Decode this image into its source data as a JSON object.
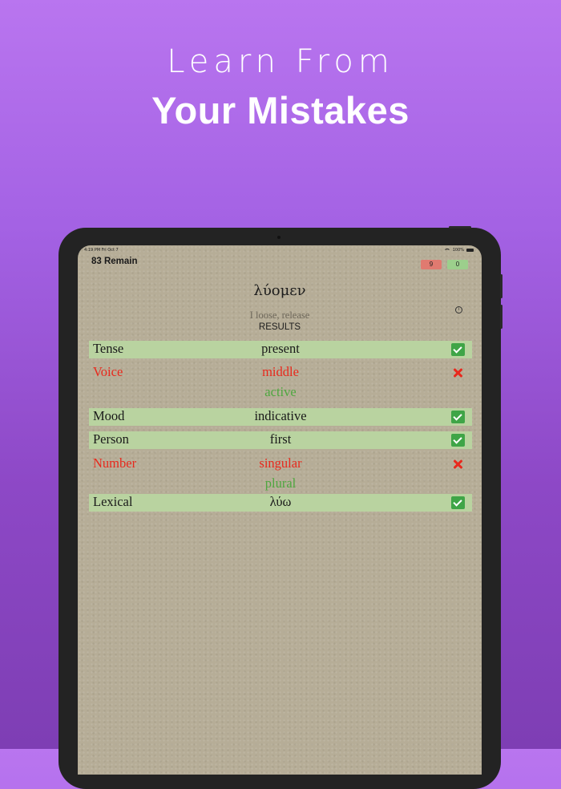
{
  "headline": {
    "top": "Learn From",
    "bottom": "Your Mistakes"
  },
  "status": {
    "time": "4:19 PM  Fri Oct 7",
    "battery": "100%"
  },
  "header": {
    "remain": "83 Remain",
    "wrong_count": "9",
    "correct_count": "0"
  },
  "word": {
    "greek": "λύομεν",
    "gloss": "I loose, release",
    "info_glyph": "i"
  },
  "results_label": "RESULTS",
  "rows": [
    {
      "label": "Tense",
      "answer": "present",
      "status": "correct",
      "correction": ""
    },
    {
      "label": "Voice",
      "answer": "middle",
      "status": "wrong",
      "correction": "active"
    },
    {
      "label": "Mood",
      "answer": "indicative",
      "status": "correct",
      "correction": ""
    },
    {
      "label": "Person",
      "answer": "first",
      "status": "correct",
      "correction": ""
    },
    {
      "label": "Number",
      "answer": "singular",
      "status": "wrong",
      "correction": "plural"
    },
    {
      "label": "Lexical",
      "answer": "λύω",
      "status": "correct",
      "correction": ""
    }
  ],
  "colors": {
    "background_top": "#b975ef",
    "background_bottom": "#7e3eb4",
    "correct_row": "#b9d3a0",
    "wrong_text": "#e8291d",
    "correction_text": "#4ea73f",
    "check_icon": "#3fa547",
    "wrong_badge": "#e07a70",
    "correct_badge": "#9ccf8c"
  },
  "icons": {
    "correct": "check-icon",
    "wrong": "x-icon",
    "info": "info-icon"
  }
}
